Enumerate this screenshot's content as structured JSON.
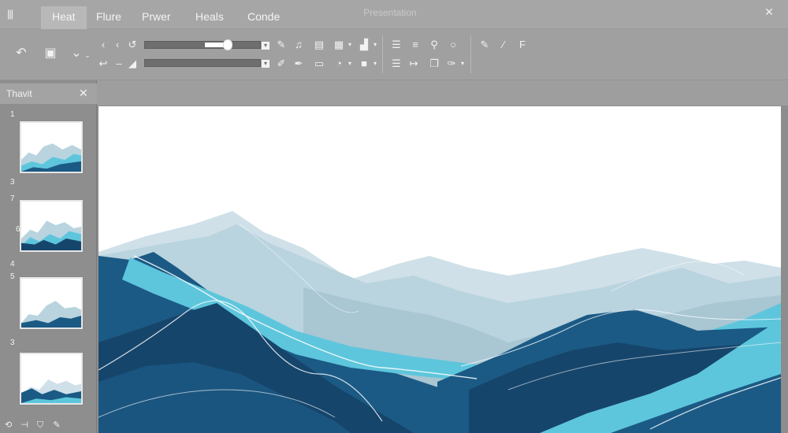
{
  "window": {
    "app_menu_icon": "grid-menu-icon",
    "title": "Presentation",
    "close_icon": "close-icon"
  },
  "tabs": [
    {
      "label": "Heat",
      "active": true
    },
    {
      "label": "Flure",
      "active": false
    },
    {
      "label": "Prwer",
      "active": false
    },
    {
      "label": "Heals",
      "active": false
    },
    {
      "label": "Conde",
      "active": false
    }
  ],
  "ribbon": {
    "slider": {
      "value": 0.72
    },
    "icons_row1": [
      "chevron-left-icon",
      "chevron-left-icon",
      "refresh-icon",
      "pen-icon",
      "music-icon",
      "layout-icon",
      "table-icon",
      "chart-icon",
      "align-icon",
      "list-icon",
      "search-icon",
      "circle-icon",
      "pencil-icon",
      "brush-icon",
      "text-icon"
    ],
    "icons_row2": [
      "link-icon",
      "minus-icon",
      "erase-icon",
      "pen-icon",
      "pen-icon",
      "folder-icon",
      "clock-icon",
      "square-icon",
      "align-icon",
      "arrow-icon",
      "copy-icon",
      "brush-icon"
    ],
    "left_icons": [
      "undo-icon",
      "save-icon",
      "check-icon"
    ]
  },
  "thumb_panel": {
    "title": "Thavit",
    "close_icon": "close-icon",
    "slides": [
      {
        "number": "1"
      },
      {
        "number": "7"
      },
      {
        "number": "4"
      },
      {
        "number": "3"
      }
    ],
    "extra_labels": [
      "3",
      "5",
      "6"
    ],
    "tools": [
      "loop-icon",
      "split-icon",
      "shield-icon",
      "pen-icon"
    ]
  },
  "colors": {
    "deep_blue": "#1b5a85",
    "navy": "#16456b",
    "cyan": "#5ec6dc",
    "pale_blue": "#b9d4df",
    "mist": "#cfe0e8",
    "ui_gray": "#a0a0a0"
  }
}
